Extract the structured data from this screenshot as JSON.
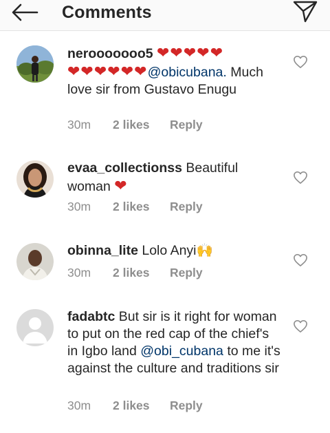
{
  "header": {
    "title": "Comments"
  },
  "comments": [
    {
      "username": "nerooooooo5",
      "hearts_line1": "❤❤❤❤❤",
      "hearts_line2": "❤❤❤❤❤❤",
      "mention": "@obicubana.",
      "text": "Much love sir from Gustavo Enugu",
      "time": "30m",
      "likes": "2 likes",
      "reply": "Reply"
    },
    {
      "username": "evaa_collectionss",
      "text": "Beautiful woman",
      "heart": "❤",
      "time": "30m",
      "likes": "2 likes",
      "reply": "Reply"
    },
    {
      "username": "obinna_lite",
      "text": "Lolo Anyi",
      "emoji": "🙌",
      "time": "30m",
      "likes": "2 likes",
      "reply": "Reply"
    },
    {
      "username": "fadabtc",
      "text": "But sir is it right for woman to put on the red cap of the chief's in Igbo land",
      "mention": "@obi_cubana",
      "text2": "to me it's against the culture and traditions sir",
      "time": "30m",
      "likes": "2 likes",
      "reply": "Reply"
    }
  ],
  "icons": {
    "back": "back-arrow-icon",
    "send": "paper-plane-icon",
    "like": "heart-outline-icon"
  },
  "colors": {
    "heart": "#d32727",
    "mention": "#003569",
    "meta": "#8e8e8e"
  }
}
